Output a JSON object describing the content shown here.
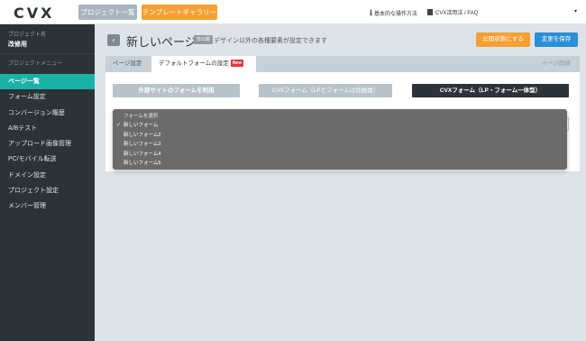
{
  "header": {
    "logo": "CVX",
    "projects_button": "プロジェクト一覧",
    "gallery_button": "テンプレートギャラリー",
    "help_link": "基本的な操作方法",
    "faq_link": "CVX活用法 / FAQ",
    "account_caret": "▾"
  },
  "sidebar": {
    "project_caption": "プロジェクト名",
    "project_name": "改修用",
    "menu_caption": "プロジェクトメニュー",
    "items": [
      {
        "label": "ページ一覧",
        "active": true
      },
      {
        "label": "フォーム設定"
      },
      {
        "label": "コンバージョン履歴"
      },
      {
        "label": "A/Bテスト"
      },
      {
        "label": "アップロード画像管理"
      },
      {
        "label": "PC/モバイル転送"
      },
      {
        "label": "ドメイン設定"
      },
      {
        "label": "プロジェクト設定"
      },
      {
        "label": "メンバー管理"
      }
    ]
  },
  "page": {
    "back_icon": "‹",
    "title": "新しいページ",
    "status_badge": "非公開",
    "description": "デザイン以外の各種要素が設定できます",
    "publish_button": "公開状態にする",
    "save_button": "変更を保存"
  },
  "tabs": {
    "settings": "ページ設定",
    "default_form": "デフォルトフォームの設定",
    "new_badge": "New",
    "delete": "ページ削除"
  },
  "form_options": {
    "external": "外部サイトのフォームを利用",
    "separate": "CVXフォーム（LPとフォームは別画面）",
    "integrated": "CVXフォーム（LP・フォーム一体型）"
  },
  "dropdown": {
    "header": "フォームを選択",
    "options": [
      {
        "label": "新しいフォーム",
        "selected": true
      },
      {
        "label": "新しいフォーム2"
      },
      {
        "label": "新しいフォーム3"
      },
      {
        "label": "新しいフォーム4"
      },
      {
        "label": "新しいフォーム5"
      }
    ]
  },
  "colors": {
    "sidebar_bg": "#2b3238",
    "active_item": "#1ab1a6",
    "orange": "#f5a033",
    "blue": "#2a8fd6",
    "main_bg": "#dde3e8"
  }
}
